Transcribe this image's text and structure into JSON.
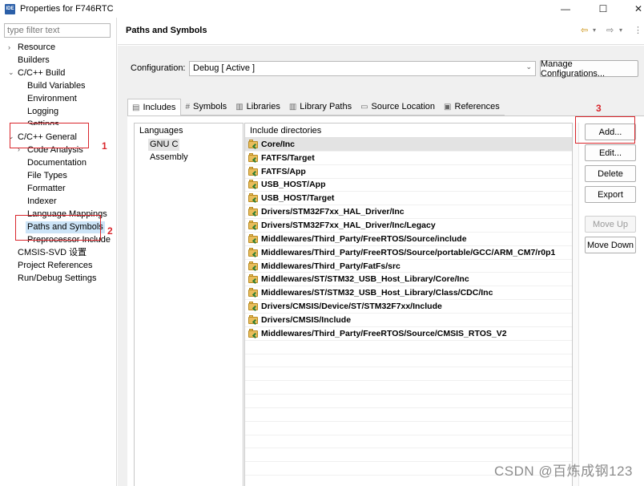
{
  "window": {
    "icon_label": "IDE",
    "title": "Properties for F746RTC",
    "controls": {
      "minimize": "—",
      "maximize": "☐",
      "close": "✕"
    }
  },
  "sidebar": {
    "filter_placeholder": "type filter text",
    "items": [
      {
        "label": "Resource",
        "arrow": "›"
      },
      {
        "label": "Builders",
        "arrow": ""
      },
      {
        "label": "C/C++ Build",
        "arrow": "⌄"
      },
      {
        "label": "Build Variables",
        "arrow": ""
      },
      {
        "label": "Environment",
        "arrow": ""
      },
      {
        "label": "Logging",
        "arrow": ""
      },
      {
        "label": "Settings",
        "arrow": ""
      },
      {
        "label": "C/C++ General",
        "arrow": "⌄"
      },
      {
        "label": "Code Analysis",
        "arrow": "›"
      },
      {
        "label": "Documentation",
        "arrow": ""
      },
      {
        "label": "File Types",
        "arrow": ""
      },
      {
        "label": "Formatter",
        "arrow": ""
      },
      {
        "label": "Indexer",
        "arrow": ""
      },
      {
        "label": "Language Mappings",
        "arrow": ""
      },
      {
        "label": "Paths and Symbols",
        "arrow": ""
      },
      {
        "label": "Preprocessor Include",
        "arrow": ""
      },
      {
        "label": "CMSIS-SVD 设置",
        "arrow": ""
      },
      {
        "label": "Project References",
        "arrow": ""
      },
      {
        "label": "Run/Debug Settings",
        "arrow": ""
      }
    ]
  },
  "header": {
    "title": "Paths and Symbols",
    "nav": {
      "back": "⇦",
      "back_menu": "▾",
      "forward": "⇨",
      "forward_menu": "▾",
      "more": "⋮"
    }
  },
  "configuration": {
    "label": "Configuration:",
    "value": "Debug  [ Active ]",
    "caret": "⌄",
    "manage_label": "Manage Configurations..."
  },
  "tabs": [
    {
      "label": "Includes",
      "icon": "▤"
    },
    {
      "label": "Symbols",
      "icon": "#"
    },
    {
      "label": "Libraries",
      "icon": "▥"
    },
    {
      "label": "Library Paths",
      "icon": "▥"
    },
    {
      "label": "Source Location",
      "icon": "▭"
    },
    {
      "label": "References",
      "icon": "▣"
    }
  ],
  "languages": {
    "header": "Languages",
    "items": [
      "GNU C",
      "Assembly"
    ]
  },
  "include_dirs": {
    "header": "Include directories",
    "rows": [
      "Core/Inc",
      "FATFS/Target",
      "FATFS/App",
      "USB_HOST/App",
      "USB_HOST/Target",
      "Drivers/STM32F7xx_HAL_Driver/Inc",
      "Drivers/STM32F7xx_HAL_Driver/Inc/Legacy",
      "Middlewares/Third_Party/FreeRTOS/Source/include",
      "Middlewares/Third_Party/FreeRTOS/Source/portable/GCC/ARM_CM7/r0p1",
      "Middlewares/Third_Party/FatFs/src",
      "Middlewares/ST/STM32_USB_Host_Library/Core/Inc",
      "Middlewares/ST/STM32_USB_Host_Library/Class/CDC/Inc",
      "Drivers/CMSIS/Device/ST/STM32F7xx/Include",
      "Drivers/CMSIS/Include",
      "Middlewares/Third_Party/FreeRTOS/Source/CMSIS_RTOS_V2"
    ]
  },
  "buttons": {
    "add": "Add...",
    "edit": "Edit...",
    "delete": "Delete",
    "export": "Export",
    "move_up": "Move Up",
    "move_down": "Move Down"
  },
  "annotations": {
    "one": "1",
    "two": "2",
    "three": "3"
  },
  "watermark": "CSDN @百炼成钢123",
  "colors": {
    "selection": "#cce4f7",
    "annotation_red": "#d9262c",
    "folder": "#e9bd5b"
  }
}
